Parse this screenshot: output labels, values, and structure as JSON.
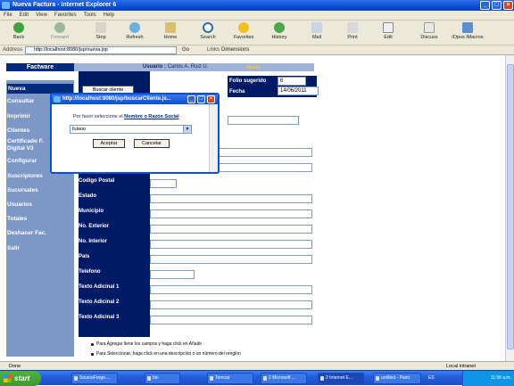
{
  "window": {
    "title": "Nueva Factura - Internet Explorer 6"
  },
  "menu": [
    "File",
    "Edit",
    "View",
    "Favorites",
    "Tools",
    "Help"
  ],
  "toolbar": {
    "back": "Back",
    "forward": "Forward",
    "stop": "Stop",
    "refresh": "Refresh",
    "home": "Home",
    "search": "Search",
    "favorites": "Favorites",
    "history": "History",
    "mail": "Mail",
    "print": "Print",
    "edit": "Edit",
    "discuss": "Discuss",
    "iopus": "iOpus iMacros"
  },
  "address": {
    "label": "Address",
    "url": "http://localhost:8080/jsp/nueva.jsp",
    "go": "Go",
    "links": "Links",
    "dimensions": "Dimensions"
  },
  "app": {
    "logo": "Factware",
    "user_label": "Usuario :",
    "user_name": "Carlos A. Ruiz U.",
    "help": "Ayuda",
    "folio_label": "Folio sugerido",
    "folio_value": "6",
    "fecha_label": "Fecha",
    "fecha_value": "14/06/2011",
    "buscar_button": "Buscar cliente"
  },
  "nav": [
    "Nueva",
    "Consultar",
    "Imprimir",
    "Clientes",
    "Certificado F. Digital V3",
    "Configurar",
    "Suscriptores",
    "Sucursales",
    "Usuarios",
    "Totales",
    "Deshacer Fac.",
    "Salir"
  ],
  "fields": [
    "Codigo Postal",
    "Estado",
    "Municipio",
    "No. Exterior",
    "No. Interior",
    "Pais",
    "Telefono",
    "Texto Adicinal 1",
    "Texto Adicinal 2",
    "Texto Adicinal 3"
  ],
  "notes": [
    "Para Agregar llene los campos y haga click en Añadir",
    "Para Seleccionar, haga click en una descripción o un número del renglón"
  ],
  "popup": {
    "title": "http://localhost:8080/jsp/buscarCliente.js...",
    "message_prefix": "Por favor seleccione el",
    "message_link": "Nombre o Razón Social",
    "selected": "fulano",
    "accept": "Aceptar",
    "cancel": "Cancelar"
  },
  "status": {
    "text": "Done",
    "zone": "Local intranet"
  },
  "taskbar": {
    "start": "start",
    "tasks": [
      "SourceForge....",
      "bin",
      "Tomcat",
      "2 Microsoft ...",
      "2 Internet E...",
      "untitled - Paint"
    ],
    "lang": "ES",
    "clock": "11:56 a.m."
  },
  "colors": {
    "navy": "#002b7a",
    "sidebar": "#7d97c6",
    "header_band": "#9fb2d8",
    "xp_blue": "#245edb"
  }
}
